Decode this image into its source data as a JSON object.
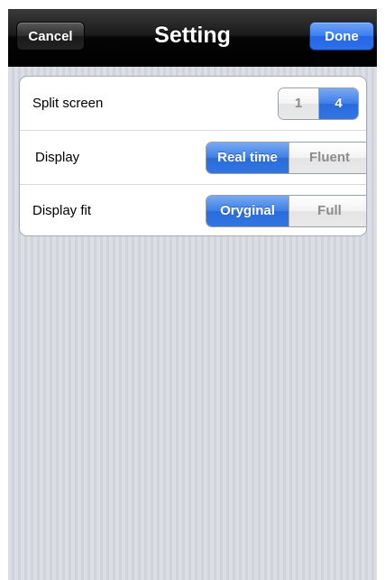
{
  "navbar": {
    "title": "Setting",
    "cancel_label": "Cancel",
    "done_label": "Done"
  },
  "settings": {
    "split_screen": {
      "label": "Split screen",
      "options": [
        "1",
        "4"
      ],
      "selected": "4"
    },
    "display": {
      "label": "Display",
      "options": [
        "Real time",
        "Fluent"
      ],
      "selected": "Real time"
    },
    "display_fit": {
      "label": "Display fit",
      "options": [
        "Oryginal",
        "Full"
      ],
      "selected": "Oryginal"
    }
  },
  "colors": {
    "accent": "#3d7ee6",
    "navbar": "#1b1b1b",
    "background": "#d3d7de"
  }
}
